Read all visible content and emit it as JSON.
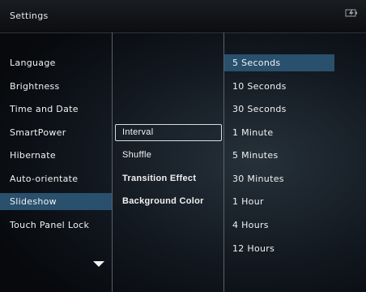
{
  "header": {
    "title": "Settings",
    "battery_icon": "battery-charging-icon"
  },
  "menu": {
    "items": [
      {
        "label": "Language"
      },
      {
        "label": "Brightness"
      },
      {
        "label": "Time and Date"
      },
      {
        "label": "SmartPower"
      },
      {
        "label": "Hibernate"
      },
      {
        "label": "Auto-orientate"
      },
      {
        "label": "Slideshow",
        "selected": true
      },
      {
        "label": "Touch Panel Lock"
      }
    ],
    "scroll_icon": "triangle-down-icon"
  },
  "submenu": {
    "items": [
      {
        "label": "Interval",
        "focused": true
      },
      {
        "label": "Shuffle"
      },
      {
        "label": "Transition Effect"
      },
      {
        "label": "Background Color"
      }
    ]
  },
  "options": {
    "items": [
      {
        "label": "5 Seconds",
        "selected": true
      },
      {
        "label": "10 Seconds"
      },
      {
        "label": "30 Seconds"
      },
      {
        "label": "1 Minute"
      },
      {
        "label": "5 Minutes"
      },
      {
        "label": "30 Minutes"
      },
      {
        "label": "1 Hour"
      },
      {
        "label": "4 Hours"
      },
      {
        "label": "12 Hours"
      }
    ]
  },
  "colors": {
    "selection": "#29506c",
    "focus_border": "#d8dde2"
  }
}
